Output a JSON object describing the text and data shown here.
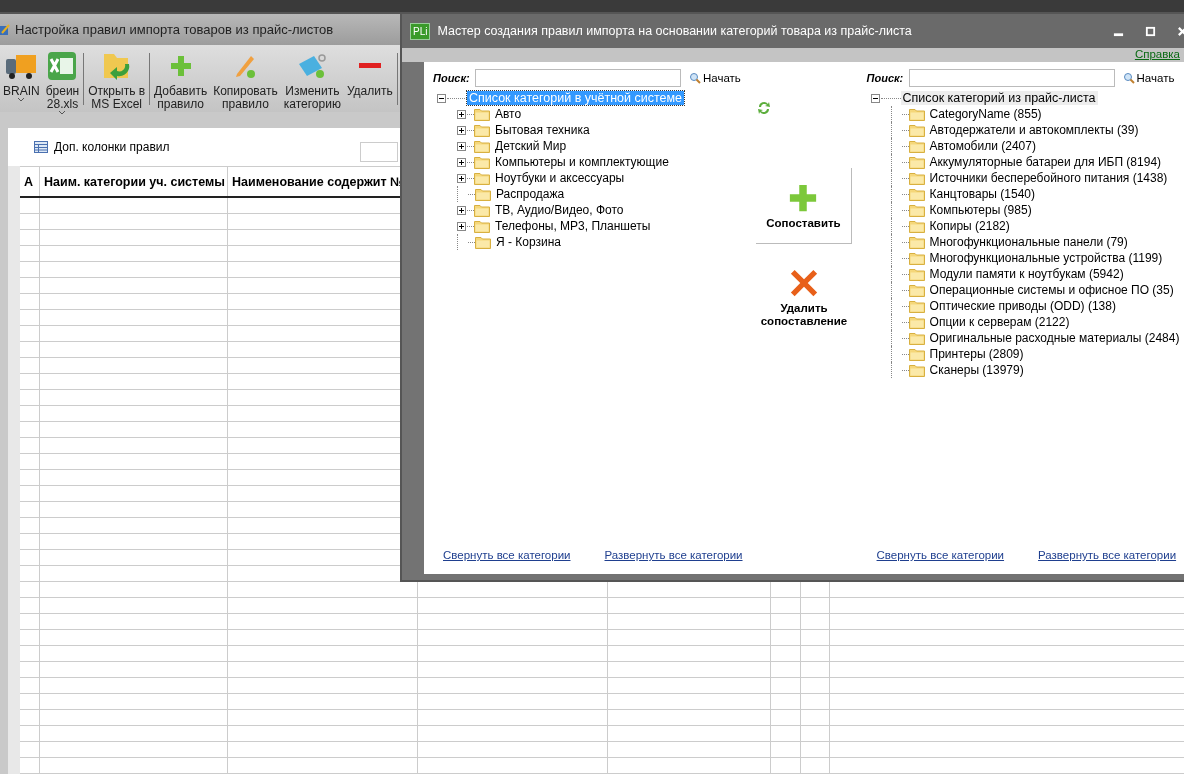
{
  "main_window": {
    "title": "Настройка правил импорта товаров из прайс-листов",
    "toolbar_groups": [
      [
        {
          "lines": [
            "BRAIN"
          ],
          "dropdown": true
        },
        {
          "lines": [
            "бреин",
            "28.xls"
          ],
          "dropdown": true
        }
      ],
      [
        {
          "lines": [
            "Открыть в",
            "MS Excel"
          ]
        }
      ],
      [
        {
          "lines": [
            "Добавить",
            "правило"
          ]
        },
        {
          "lines": [
            "Копировать",
            "правило"
          ]
        },
        {
          "lines": [
            "Изменить",
            "категорию"
          ]
        },
        {
          "lines": [
            "Удалить"
          ]
        }
      ]
    ],
    "columns_button": "Доп. колонки правил",
    "table": {
      "columns": [
        "A",
        "Наим. категории уч. системы",
        "Наименование содержит №"
      ]
    }
  },
  "dialog": {
    "logo_text": "PLi",
    "title": "Мастер создания правил импорта на основании категорий товара из прайс-листа",
    "help_link": "Справка",
    "panels": [
      {
        "search": {
          "label": "Поиск:",
          "button": "Начать"
        },
        "tree": {
          "label": "Список категорий в учётной системе",
          "selected": true,
          "expanded": true,
          "children": [
            {
              "label": "Авто",
              "expandable": true
            },
            {
              "label": "Бытовая техника",
              "expandable": true
            },
            {
              "label": "Детский Мир",
              "expandable": true
            },
            {
              "label": "Компьютеры и комплектующие",
              "expandable": true
            },
            {
              "label": "Ноутбуки и аксессуары",
              "expandable": true
            },
            {
              "label": "Распродажа",
              "expandable": false
            },
            {
              "label": "ТВ, Аудио/Видео, Фото",
              "expandable": true
            },
            {
              "label": "Телефоны, МР3, Планшеты",
              "expandable": true
            },
            {
              "label": "Я - Корзина",
              "expandable": false
            }
          ]
        },
        "links": [
          "Свернуть все категории",
          "Развернуть все категории"
        ]
      },
      {
        "search": {
          "label": "Поиск:",
          "button": "Начать"
        },
        "tree": {
          "label": "Список категорий из прайс-листа",
          "selected": false,
          "expanded": true,
          "children": [
            {
              "label": "CategoryName (855)",
              "expandable": false
            },
            {
              "label": "Автодержатели и автокомплекты (39)",
              "expandable": false
            },
            {
              "label": "Автомобили (2407)",
              "expandable": false
            },
            {
              "label": "Аккумуляторные батареи для ИБП (8194)",
              "expandable": false
            },
            {
              "label": "Источники бесперебойного питания (1438)",
              "expandable": false
            },
            {
              "label": "Канцтовары (1540)",
              "expandable": false
            },
            {
              "label": "Компьютеры (985)",
              "expandable": false
            },
            {
              "label": "Копиры (2182)",
              "expandable": false
            },
            {
              "label": "Многофункциональные панели (79)",
              "expandable": false
            },
            {
              "label": "Многофункциональные устройства (1199)",
              "expandable": false
            },
            {
              "label": "Модули памяти к ноутбукам (5942)",
              "expandable": false
            },
            {
              "label": "Операционные системы и офисное ПО (35)",
              "expandable": false
            },
            {
              "label": "Оптические приводы (ODD) (138)",
              "expandable": false
            },
            {
              "label": "Опции к серверам (2122)",
              "expandable": false
            },
            {
              "label": "Оригинальные расходные материалы (2484)",
              "expandable": false
            },
            {
              "label": "Принтеры (2809)",
              "expandable": false
            },
            {
              "label": "Сканеры (13979)",
              "expandable": false
            }
          ]
        },
        "links": [
          "Свернуть все категории",
          "Развернуть все категории"
        ]
      }
    ],
    "actions": [
      {
        "kind": "match",
        "label": "Сопоставить"
      },
      {
        "kind": "unmatch",
        "label": "Удалить сопоставление"
      }
    ]
  }
}
